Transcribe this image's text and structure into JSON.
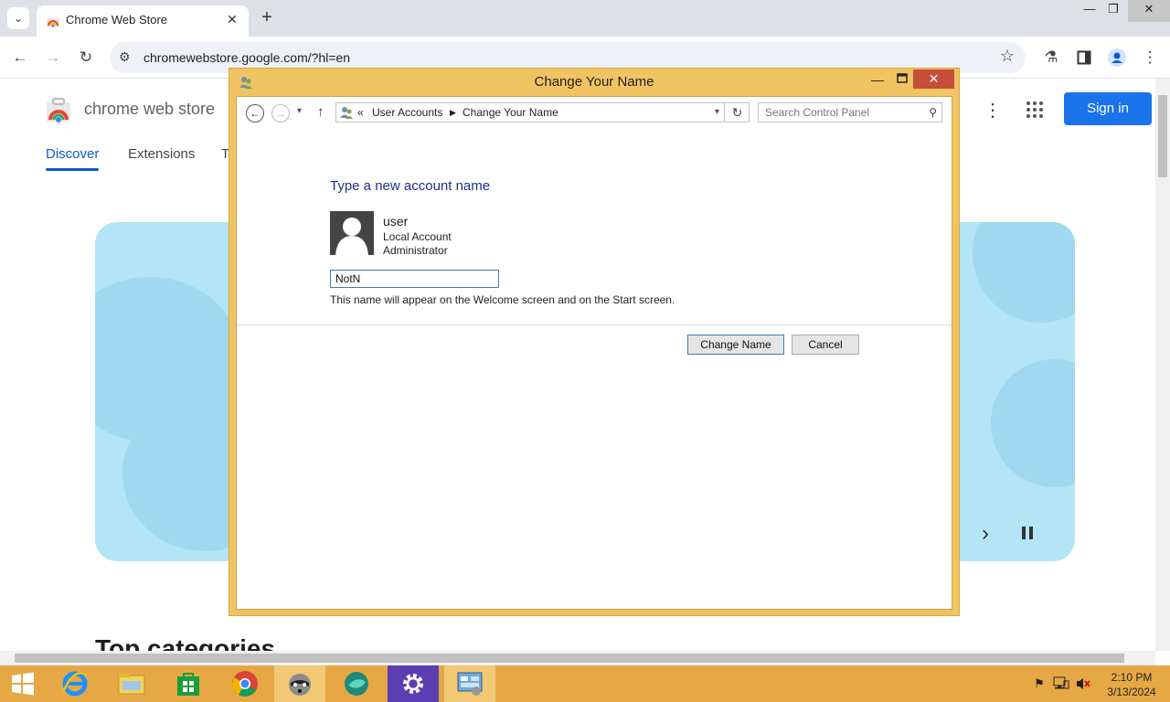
{
  "browser": {
    "tab_title": "Chrome Web Store",
    "url": "chromewebstore.google.com/?hl=en",
    "window_controls": {
      "minimize": "—",
      "maximize": "❐",
      "close": "✕"
    }
  },
  "webstore": {
    "title": "chrome web store",
    "nav": [
      {
        "label": "Discover",
        "active": true
      },
      {
        "label": "Extensions",
        "active": false
      },
      {
        "label": "T",
        "active": false
      }
    ],
    "sign_in": "Sign in",
    "section_title": "Top categories",
    "colors": {
      "accent": "#0b57d0",
      "signin": "#1a73e8",
      "hero": "#b3e5f7"
    }
  },
  "dialog": {
    "title": "Change Your Name",
    "breadcrumb": {
      "prefix": "«",
      "parent": "User Accounts",
      "current": "Change Your Name"
    },
    "search_placeholder": "Search Control Panel",
    "heading": "Type a new account name",
    "user": {
      "name": "user",
      "account_type": "Local Account",
      "role": "Administrator"
    },
    "new_name_value": "NotN",
    "hint": "This name will appear on the Welcome screen and on the Start screen.",
    "buttons": {
      "change": "Change Name",
      "cancel": "Cancel"
    },
    "colors": {
      "frame": "#f0c462",
      "heading": "#1e3287",
      "close": "#c74e3a"
    }
  },
  "taskbar": {
    "items": [
      "start-icon",
      "internet-explorer-icon",
      "file-explorer-icon",
      "store-icon",
      "chrome-icon",
      "raccoon-app-icon",
      "teal-app-icon",
      "settings-icon",
      "control-panel-icon"
    ],
    "clock_time": "2:10 PM",
    "clock_date": "3/13/2024",
    "color": "#e6a845"
  }
}
